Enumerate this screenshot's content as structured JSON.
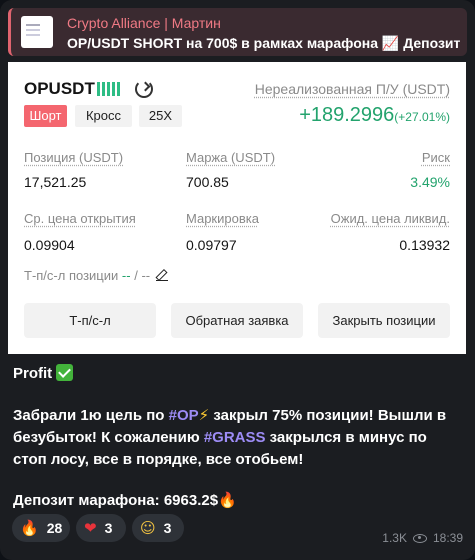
{
  "reply": {
    "title": "Crypto Alliance | Мартин",
    "text": "OP/USDT SHORT на 700$ в рамках марафона 📈 Депозит ..."
  },
  "position": {
    "symbol": "OPUSDT",
    "side": "Шорт",
    "margin_mode": "Кросс",
    "leverage": "25X",
    "pnl_label": "Нереализованная П/У (USDT)",
    "pnl_value": "+189.2996",
    "pnl_percent": "(+27.01%)",
    "fields": {
      "size_label": "Позиция (USDT)",
      "size_value": "17,521.25",
      "margin_label": "Маржа (USDT)",
      "margin_value": "700.85",
      "risk_label": "Риск",
      "risk_value": "3.49%",
      "entry_label": "Ср. цена открытия",
      "entry_value": "0.09904",
      "mark_label": "Маркировка",
      "mark_value": "0.09797",
      "liq_label": "Ожид. цена ликвид.",
      "liq_value": "0.13932"
    },
    "tpsl_label": "Т-п/с-л позиции",
    "tpsl_tp": "--",
    "tpsl_sep": "/",
    "tpsl_sl": "--",
    "buttons": {
      "tpsl": "Т-п/с-л",
      "reverse": "Обратная заявка",
      "close": "Закрыть позиции"
    }
  },
  "message": {
    "heading": "Profit",
    "line1_a": "Забрали 1ю цель по ",
    "tag_op": "#OP",
    "line1_b": " закрыл 75% позиции! Вышли в безубыток! К сожалению ",
    "tag_grass": "#GRASS",
    "line1_c": " закрылся в минус по стоп лосу, все в порядке, все отобьем!",
    "deposit": "Депозит марафона: 6963.2$"
  },
  "reactions": [
    {
      "icon": "fire-emoji",
      "count": "28"
    },
    {
      "icon": "heart-emoji",
      "count": "3"
    },
    {
      "icon": "money-face-emoji",
      "count": "3"
    }
  ],
  "meta": {
    "views": "1.3K",
    "time": "18:39"
  },
  "colors": {
    "accent_green": "#23a36d",
    "short_red": "#f4666f",
    "hashtag": "#9d8cf5",
    "reply_title": "#f07a85"
  }
}
